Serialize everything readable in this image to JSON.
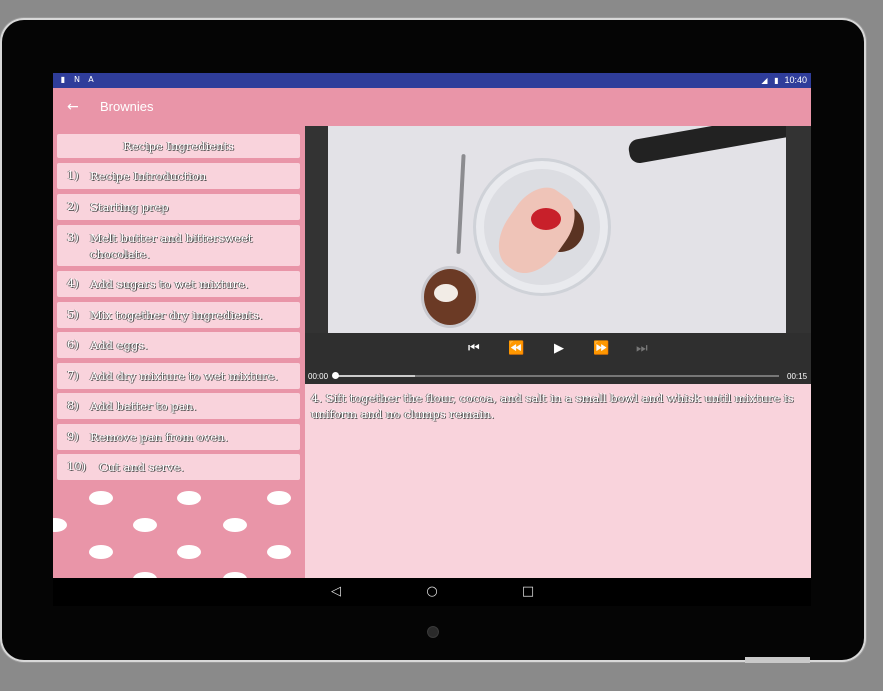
{
  "status_bar": {
    "time": "10:40",
    "left_icons": [
      "sim-icon",
      "n-icon",
      "a-icon"
    ],
    "right_icons": [
      "signal-icon",
      "battery-icon"
    ]
  },
  "app_bar": {
    "title": "Brownies",
    "back_icon": "arrow-back-icon",
    "background": "#e995a8"
  },
  "ingredients_header": "Recipe Ingredients",
  "steps": [
    {
      "num": "1)",
      "label": "Recipe Introduction"
    },
    {
      "num": "2)",
      "label": "Starting prep"
    },
    {
      "num": "3)",
      "label": "Melt butter and bittersweet chocolate."
    },
    {
      "num": "4)",
      "label": "Add sugars to wet mixture."
    },
    {
      "num": "5)",
      "label": "Mix together dry ingredients."
    },
    {
      "num": "6)",
      "label": "Add eggs."
    },
    {
      "num": "7)",
      "label": "Add dry mixture to wet mixture."
    },
    {
      "num": "8)",
      "label": "Add batter to pan."
    },
    {
      "num": "9)",
      "label": "Remove pan from oven."
    },
    {
      "num": "10)",
      "label": "Cut and serve."
    }
  ],
  "player": {
    "current_time": "00:00",
    "duration": "00:15",
    "buffered_fraction": 0.18,
    "position_fraction": 0.0,
    "controls": [
      "skip-previous-icon",
      "rewind-icon",
      "play-icon",
      "fast-forward-icon",
      "skip-next-icon"
    ]
  },
  "step_description": "4. Sift together the flour, cocoa, and salt in a small bowl and whisk until mixture is uniform and no clumps remain.",
  "nav_bar": [
    "nav-back-icon",
    "nav-home-icon",
    "nav-recents-icon"
  ],
  "colors": {
    "status_bar": "#2f3d9a",
    "accent_pink": "#e995a8",
    "card_pink": "#f9d3dc"
  }
}
